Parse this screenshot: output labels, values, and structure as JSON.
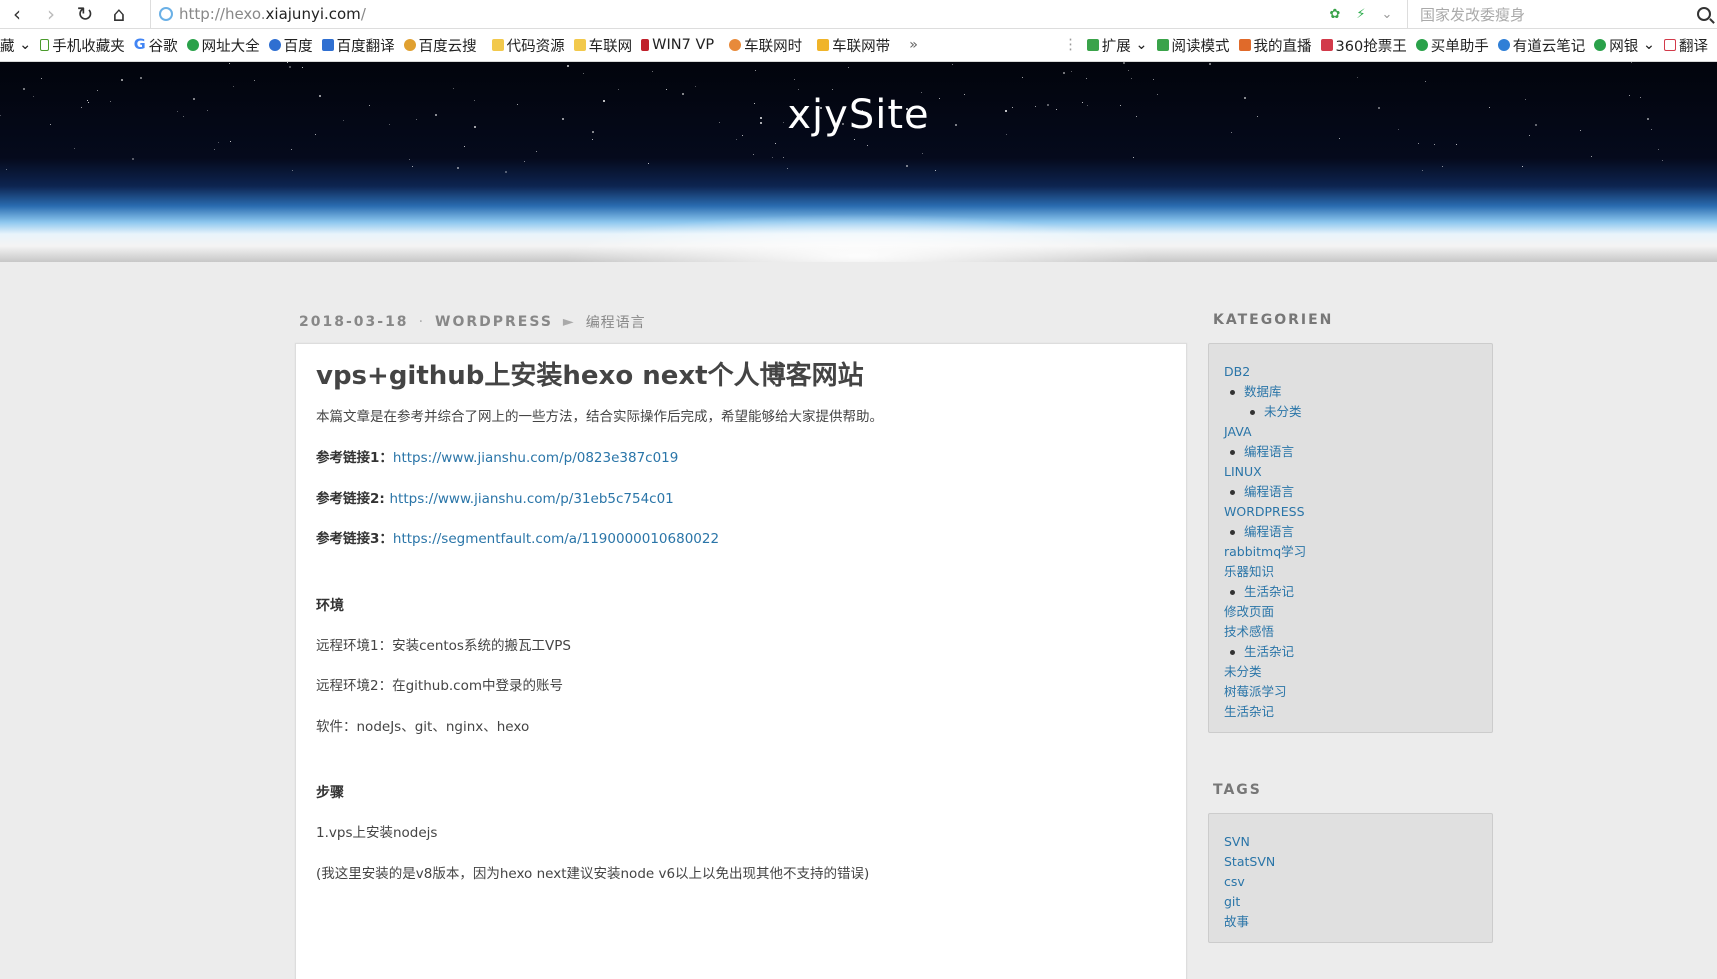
{
  "browser": {
    "url_scheme": "http://hexo.",
    "url_host": "xiajunyi.com",
    "url_path": "/",
    "search_placeholder": "国家发改委瘦身"
  },
  "bookmarks": {
    "left": [
      "藏",
      "手机收藏夹",
      "谷歌",
      "网址大全",
      "百度",
      "百度翻译",
      "百度云搜",
      "代码资源",
      "车联网",
      "WIN7 VP",
      "车联网时",
      "车联网带",
      "»"
    ],
    "right": [
      "扩展",
      "阅读模式",
      "我的直播",
      "360抢票王",
      "买单助手",
      "有道云笔记",
      "网银",
      "翻译"
    ]
  },
  "site": {
    "title": "xjySite"
  },
  "post": {
    "date": "2018-03-18",
    "category": "WORDPRESS",
    "subcategory": "编程语言",
    "title": "vps+github上安装hexo next个人博客网站",
    "intro": "本篇文章是在参考并综合了网上的一些方法，结合实际操作后完成，希望能够给大家提供帮助。",
    "refs": [
      {
        "label": "参考链接1：",
        "url": "https://www.jianshu.com/p/0823e387c019"
      },
      {
        "label": "参考链接2: ",
        "url": "https://www.jianshu.com/p/31eb5c754c01"
      },
      {
        "label": "参考链接3：",
        "url": "https://segmentfault.com/a/1190000010680022"
      }
    ],
    "env_heading": "环境",
    "env": [
      "远程环境1：安装centos系统的搬瓦工VPS",
      "远程环境2：在github.com中登录的账号",
      "软件：nodeJs、git、nginx、hexo"
    ],
    "steps_heading": "步骤",
    "step1": "1.vps上安装nodejs",
    "step1_note": "(我这里安装的是v8版本，因为hexo next建议安装node v6以上以免出现其他不支持的错误)"
  },
  "sidebar": {
    "categories_heading": "KATEGORIEN",
    "categories": [
      {
        "label": "DB2",
        "level": 0
      },
      {
        "label": "数据库",
        "level": 1
      },
      {
        "label": "未分类",
        "level": 2
      },
      {
        "label": "JAVA",
        "level": 0
      },
      {
        "label": "编程语言",
        "level": 1
      },
      {
        "label": "LINUX",
        "level": 0
      },
      {
        "label": "编程语言",
        "level": 1
      },
      {
        "label": "WORDPRESS",
        "level": 0
      },
      {
        "label": "编程语言",
        "level": 1
      },
      {
        "label": "rabbitmq学习",
        "level": 0
      },
      {
        "label": "乐器知识",
        "level": 0
      },
      {
        "label": "生活杂记",
        "level": 1
      },
      {
        "label": "修改页面",
        "level": 0
      },
      {
        "label": "技术感悟",
        "level": 0
      },
      {
        "label": "生活杂记",
        "level": 1
      },
      {
        "label": "未分类",
        "level": 0
      },
      {
        "label": "树莓派学习",
        "level": 0
      },
      {
        "label": "生活杂记",
        "level": 0
      }
    ],
    "tags_heading": "TAGS",
    "tags": [
      "SVN",
      "StatSVN",
      "csv",
      "git",
      "故事"
    ]
  }
}
